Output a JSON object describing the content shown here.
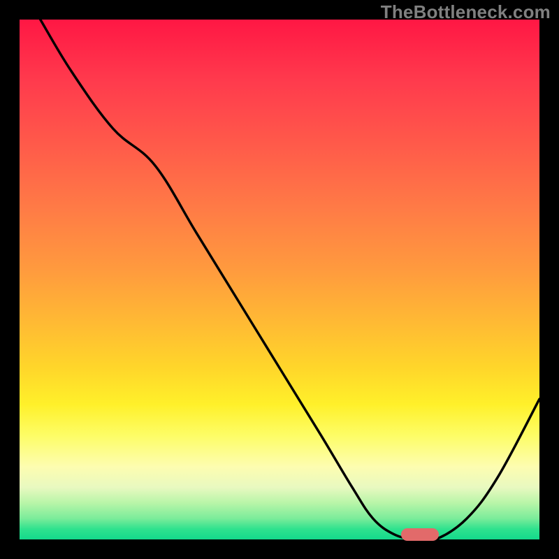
{
  "watermark": "TheBottleneck.com",
  "colors": {
    "page_bg": "#000000",
    "watermark": "#808080",
    "curve": "#000000",
    "marker": "#e26a6a"
  },
  "chart_data": {
    "type": "line",
    "title": "",
    "xlabel": "",
    "ylabel": "",
    "xlim": [
      0,
      100
    ],
    "ylim": [
      0,
      100
    ],
    "grid": false,
    "legend": false,
    "series": [
      {
        "name": "bottleneck-curve",
        "x": [
          4,
          10,
          18,
          26,
          34,
          42,
          50,
          58,
          64,
          68,
          72,
          76,
          80,
          86,
          92,
          100
        ],
        "values": [
          100,
          90,
          79,
          72,
          59,
          46,
          33,
          20,
          10,
          4,
          1,
          0,
          0,
          4,
          12,
          27
        ]
      }
    ],
    "marker": {
      "x": 77,
      "y": 1
    },
    "gradient_background": {
      "top": "#ff1744",
      "mid": "#ffd62a",
      "bottom": "#14d98c"
    }
  }
}
